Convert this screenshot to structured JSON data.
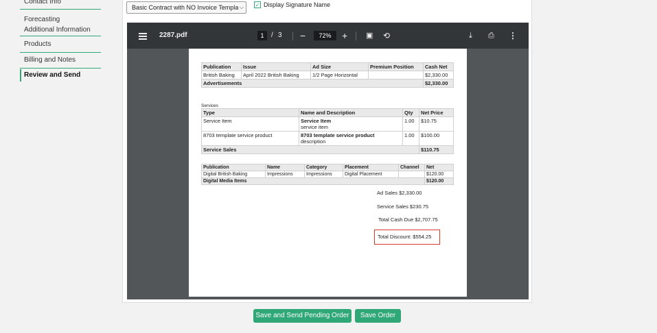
{
  "sidebar": {
    "items": [
      {
        "label": "Contact Info"
      },
      {
        "label": "Forecasting"
      },
      {
        "label": "Additional Information"
      },
      {
        "label": "Products"
      },
      {
        "label": "Billing and Notes"
      },
      {
        "label": "Review and Send"
      }
    ]
  },
  "form": {
    "template_select": "Basic Contract with NO Invoice Templat",
    "signature_label": "Display Signature Name",
    "signature_checked": true
  },
  "viewer": {
    "filename": "2287.pdf",
    "current_page": "1",
    "page_separator": "/",
    "total_pages": "3",
    "zoom": "72%",
    "icons": [
      "menu-icon",
      "zoom-out-icon",
      "zoom-in-icon",
      "fit-page-icon",
      "rotate-icon",
      "download-icon",
      "print-icon",
      "more-options-icon"
    ]
  },
  "document": {
    "ads_table": {
      "headers": [
        "Publication",
        "Issue",
        "Ad Size",
        "Premium Position",
        "Cash Net"
      ],
      "rows": [
        [
          "British Baking",
          "April 2022 British Baking",
          "1/2 Page Horizontal",
          "",
          "$2,330.00"
        ]
      ],
      "summary_label": "Advertisements",
      "summary_value": "$2,330.00"
    },
    "services_label": "Services",
    "services_table": {
      "headers": [
        "Type",
        "Name and Description",
        "Qty",
        "Net Price"
      ],
      "rows": [
        {
          "type": "Service Item",
          "name": "Service Item",
          "description": "service item",
          "qty": "1.00",
          "price": "$10.75"
        },
        {
          "type": "8703 template service product",
          "name": "8703 template service product",
          "description": "description",
          "qty": "1.00",
          "price": "$100.00"
        }
      ],
      "summary_label": "Service Sales",
      "summary_value": "$110.75"
    },
    "digital_table": {
      "headers": [
        "Publication",
        "Name",
        "Category",
        "Placement",
        "Channel",
        "Net"
      ],
      "rows": [
        [
          "Digital British Baking",
          "Impressions",
          "Impressions",
          "Digital Placement",
          "",
          "$120.00"
        ]
      ],
      "summary_label": "Digital Media Items",
      "summary_value": "$120.00"
    },
    "totals": {
      "ad_sales": "Ad Sales $2,330.00",
      "service_sales": "Service Sales $230.75",
      "total_cash_due": "Total Cash Due $2,707.75",
      "total_discount": "Total Discount: $554.25"
    }
  },
  "buttons": {
    "save_send": "Save and Send Pending Order",
    "save": "Save Order"
  },
  "colors": {
    "accent": "#2fa777",
    "toolbar": "#323639",
    "viewer_bg": "#525659",
    "highlight": "#d2392b"
  }
}
